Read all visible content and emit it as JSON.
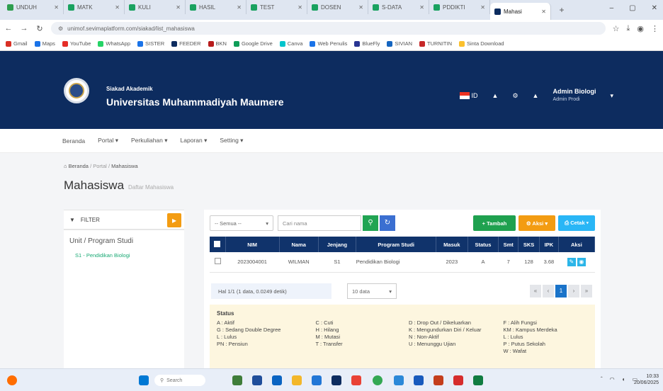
{
  "browser": {
    "tabs": [
      {
        "title": "UNDUH",
        "color": "#2e9e4f"
      },
      {
        "title": "MATK",
        "color": "#1aa260"
      },
      {
        "title": "KULI",
        "color": "#1aa260"
      },
      {
        "title": "HASIL",
        "color": "#1aa260"
      },
      {
        "title": "TEST",
        "color": "#1aa260"
      },
      {
        "title": "DOSEN",
        "color": "#1aa260"
      },
      {
        "title": "S-DATA",
        "color": "#1aa260"
      },
      {
        "title": "PDDIKTI",
        "color": "#1aa260"
      },
      {
        "title": "Mahasi",
        "color": "#0d2c5f"
      }
    ],
    "new_tab": "+",
    "window_controls": [
      "–",
      "▢",
      "✕"
    ],
    "nav": [
      "←",
      "→",
      "↻"
    ],
    "url": "unimof.sevimaplatform.com/siakad/list_mahasiswa",
    "right_icons": [
      "☆",
      "⤓",
      "◉",
      "⋮"
    ],
    "bookmarks": [
      {
        "label": "Gmail",
        "color": "#d93025"
      },
      {
        "label": "Maps",
        "color": "#1a73e8"
      },
      {
        "label": "YouTube",
        "color": "#e52d27"
      },
      {
        "label": "WhatsApp",
        "color": "#25d366"
      },
      {
        "label": "SISTER",
        "color": "#1a73e8"
      },
      {
        "label": "FEEDER",
        "color": "#0d2c5f"
      },
      {
        "label": "BKN",
        "color": "#b71c1c"
      },
      {
        "label": "Google Drive",
        "color": "#0f9d58"
      },
      {
        "label": "Canva",
        "color": "#00c4cc"
      },
      {
        "label": "Web Penulis",
        "color": "#1a73e8"
      },
      {
        "label": "BlueFly",
        "color": "#283593"
      },
      {
        "label": "SIVIAN",
        "color": "#1565c0"
      },
      {
        "label": "TURNITIN",
        "color": "#c62828"
      },
      {
        "label": "Sinta Download",
        "color": "#fbc02d"
      }
    ]
  },
  "header": {
    "brand_small": "Siakad Akademik",
    "brand_big": "Universitas Muhammadiyah Maumere",
    "lang": "ID",
    "user_name": "Admin Biologi",
    "user_role": "Admin Prodi"
  },
  "menu": [
    "Beranda",
    "Portal ▾",
    "Perkuliahan ▾",
    "Laporan ▾",
    "Setting ▾"
  ],
  "breadcrumb": {
    "home": "Beranda",
    "mid": "Portal",
    "current": "Mahasiswa"
  },
  "page": {
    "title": "Mahasiswa",
    "subtitle": "Daftar Mahasiswa"
  },
  "filter": {
    "title": "FILTER",
    "section": "Unit / Program Studi",
    "item": "S1 - Pendidikan Biologi"
  },
  "toolbar": {
    "select": "-- Semua --",
    "search_placeholder": "Cari nama",
    "btn_add": "+ Tambah",
    "btn_aksi": "⚙ Aksi ▾",
    "btn_cetak": "⎙ Cetak ▾"
  },
  "table": {
    "headers": [
      "NIM",
      "Nama",
      "Jenjang",
      "Program Studi",
      "Masuk",
      "Status",
      "Smt",
      "SKS",
      "IPK",
      "Aksi"
    ],
    "row": [
      "2023004001",
      "WILMAN",
      "S1",
      "Pendidikan Biologi",
      "2023",
      "A",
      "7",
      "128",
      "3.68"
    ]
  },
  "pager": {
    "info": "Hal 1/1 (1 data, 0.0249 detik)",
    "per_page": "10 data",
    "pages": [
      "«",
      "‹",
      "1",
      "›",
      "»"
    ]
  },
  "status": {
    "title": "Status",
    "col1": [
      "A : Aktif",
      "G : Sedang Double Degree",
      "L : Lulus",
      "PN : Pensiun"
    ],
    "col2": [
      "C : Cuti",
      "H : Hilang",
      "M : Mutasi",
      "T : Transfer"
    ],
    "col3": [
      "D : Drop Out / Dikeluarkan",
      "K : Mengundurkan Diri / Keluar",
      "N : Non-Aktif",
      "U : Menunggu Ujian"
    ],
    "col4": [
      "F : Alih Fungsi",
      "KM : Kampus Merdeka",
      "L : Lulus",
      "P : Putus Sekolah",
      "W : Wafat"
    ]
  },
  "taskbar": {
    "search": "Search",
    "clock_time": "10:33",
    "clock_date": "20/06/2025"
  }
}
